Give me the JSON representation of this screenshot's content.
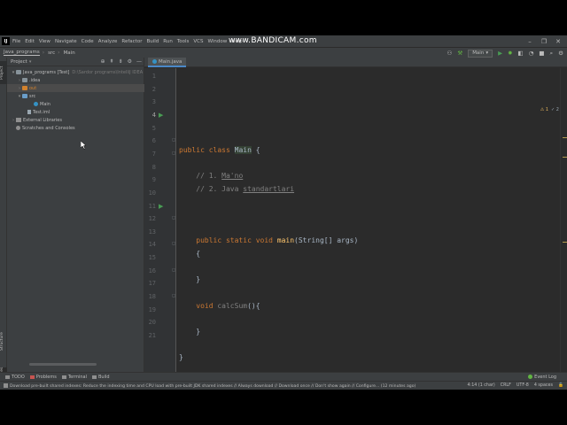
{
  "watermark": "www.BANDICAM.com",
  "menubar": {
    "logo": "IJ",
    "items": [
      "File",
      "Edit",
      "View",
      "Navigate",
      "Code",
      "Analyze",
      "Refactor",
      "Build",
      "Run",
      "Tools",
      "VCS",
      "Window",
      "Help"
    ],
    "window_controls": [
      "–",
      "❐",
      "✕"
    ]
  },
  "navbar": {
    "breadcrumbs": [
      "Java_programs",
      "src",
      "Main"
    ],
    "run_config": "Main"
  },
  "left_strip": {
    "project_tab": "Project",
    "structure_tab": "Structure",
    "favorites_tab": "Favorites"
  },
  "project": {
    "title": "Project",
    "tree": [
      {
        "label": "Java_programs [Test]",
        "dim": "D:\\Sardor programs\\IntelliJ IDEA",
        "indent": 0,
        "arrow": "▾",
        "icon": "folder"
      },
      {
        "label": ".idea",
        "dim": "",
        "indent": 1,
        "arrow": "›",
        "icon": "folder"
      },
      {
        "label": "out",
        "dim": "",
        "indent": 1,
        "arrow": "›",
        "icon": "folder-orange"
      },
      {
        "label": "src",
        "dim": "",
        "indent": 1,
        "arrow": "▾",
        "icon": "folder-blue"
      },
      {
        "label": "Main",
        "dim": "",
        "indent": 2,
        "arrow": "",
        "icon": "class"
      },
      {
        "label": "Test.iml",
        "dim": "",
        "indent": 1,
        "arrow": "",
        "icon": "file"
      },
      {
        "label": "External Libraries",
        "dim": "",
        "indent": 0,
        "arrow": "›",
        "icon": "lib"
      },
      {
        "label": "Scratches and Consoles",
        "dim": "",
        "indent": 0,
        "arrow": "",
        "icon": "scratch"
      }
    ]
  },
  "editor": {
    "tab": "Main.java",
    "warnings": "⚠ 1",
    "checks": "✓ 2",
    "line_numbers": [
      "1",
      "2",
      "3",
      "4",
      "5",
      "6",
      "7",
      "8",
      "9",
      "10",
      "11",
      "12",
      "13",
      "14",
      "15",
      "16",
      "17",
      "18",
      "19",
      "20",
      "21"
    ],
    "line4": {
      "kw": "public class ",
      "name": "Main",
      "rest": " {"
    },
    "line6": {
      "prefix": "    // 1. ",
      "word": "Ma'no"
    },
    "line7": {
      "prefix": "    // 2. Java ",
      "word": "standartlari"
    },
    "line11": {
      "kw": "    public static void ",
      "fn": "main",
      "rest": "(String[] args)"
    },
    "line12": "    {",
    "line14": "    }",
    "line16": {
      "kw": "    void ",
      "fn": "calcSum",
      "rest": "(){"
    },
    "line18": "    }",
    "line20": "}"
  },
  "bottom_tools": {
    "todo": "TODO",
    "problems": "Problems",
    "terminal": "Terminal",
    "build": "Build",
    "event_log": "Event Log"
  },
  "status": {
    "message": "Download pre-built shared indexes: Reduce the indexing time and CPU load with pre-built JDK shared indexes // Always download // Download once // Don't show again // Configure... (12 minutes ago)",
    "position": "4:14 (1 char)",
    "line_sep": "CRLF",
    "encoding": "UTF-8",
    "indent": "4 spaces"
  },
  "colors": {
    "keyword": "#cc7832",
    "comment": "#808080",
    "function": "#ffc66d",
    "run": "#499c54",
    "accent": "#4a88c7"
  }
}
